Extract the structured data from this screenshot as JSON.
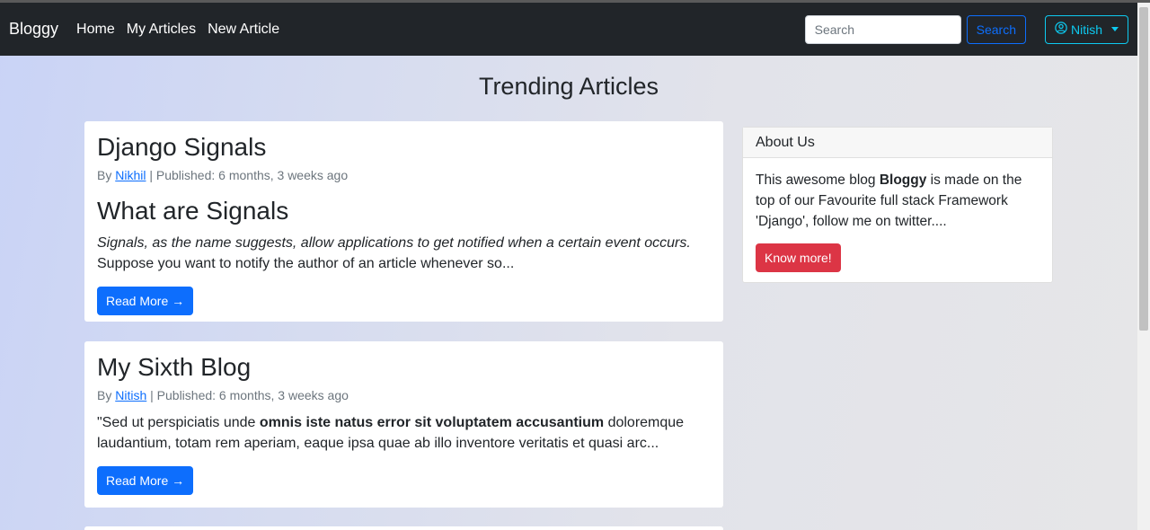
{
  "navbar": {
    "brand": "Bloggy",
    "links": [
      "Home",
      "My Articles",
      "New Article"
    ],
    "search_placeholder": "Search",
    "search_button": "Search",
    "user_button": "Nitish"
  },
  "page_title": "Trending Articles",
  "articles": [
    {
      "title": "Django Signals",
      "by_prefix": "By ",
      "author": "Nikhil",
      "published": " | Published: 6 months, 3 weeks ago",
      "sub_heading": "What are Signals",
      "excerpt_italic": "Signals, as the name suggests, allow applications to get notified when a certain event occurs.",
      "excerpt_rest": " Suppose you want to notify the author of an article whenever so...",
      "read_more": "Read More →"
    },
    {
      "title": "My Sixth Blog",
      "by_prefix": "By ",
      "author": "Nitish",
      "published": " | Published: 6 months, 3 weeks ago",
      "excerpt_start": "\"Sed ut perspiciatis unde ",
      "excerpt_bold": "omnis iste natus error sit voluptatem accusantium",
      "excerpt_end": " doloremque laudantium, totam rem aperiam, eaque ipsa quae ab illo inventore veritatis et quasi arc...",
      "read_more": "Read More →"
    }
  ],
  "about": {
    "header": "About Us",
    "text_start": "This awesome blog ",
    "text_bold": "Bloggy",
    "text_end": " is made on the top of our Favourite full stack Framework 'Django', follow me on twitter....",
    "button": "Know more!"
  },
  "colors": {
    "navbar_bg": "#212529",
    "primary": "#0d6efd",
    "info": "#0dcaf0",
    "danger": "#dc3545"
  }
}
